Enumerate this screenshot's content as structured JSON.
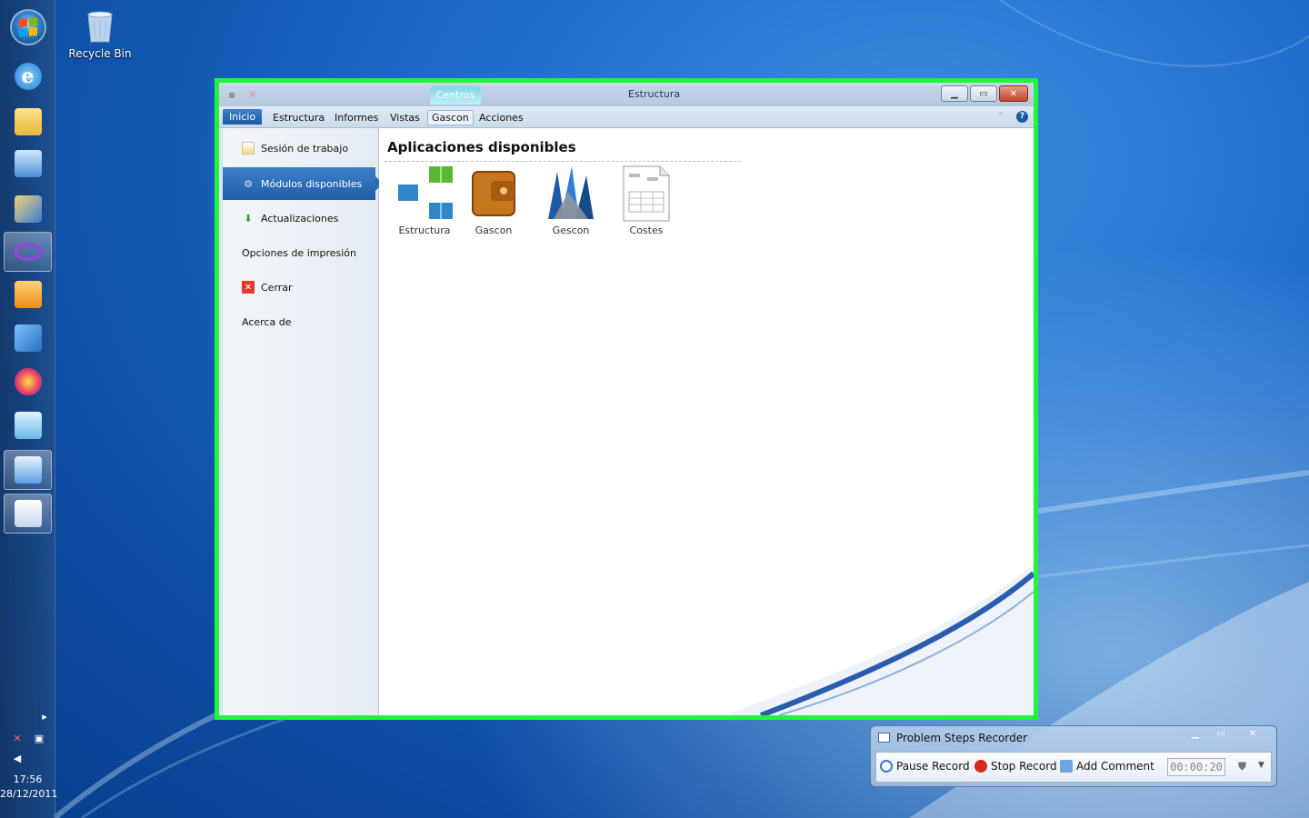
{
  "desktop": {
    "recycle_bin_label": "Recycle Bin"
  },
  "taskbar": {
    "time": "17:56",
    "date": "28/12/2011"
  },
  "window": {
    "context_tab": "Centros",
    "title": "Estructura",
    "ribbon_tabs": [
      "Inicio",
      "Estructura",
      "Informes",
      "Vistas",
      "Gascon",
      "Acciones"
    ],
    "sidebar": [
      {
        "label": "Sesión de trabajo"
      },
      {
        "label": "Módulos disponibles"
      },
      {
        "label": "Actualizaciones"
      },
      {
        "label": "Opciones de impresión"
      },
      {
        "label": "Cerrar"
      },
      {
        "label": "Acerca de"
      }
    ],
    "content_title": "Aplicaciones disponibles",
    "apps": [
      "Estructura",
      "Gascon",
      "Gescon",
      "Costes"
    ]
  },
  "psr": {
    "title": "Problem Steps Recorder",
    "pause": "Pause Record",
    "stop": "Stop Record",
    "comment": "Add Comment",
    "timer": "00:00:20"
  }
}
